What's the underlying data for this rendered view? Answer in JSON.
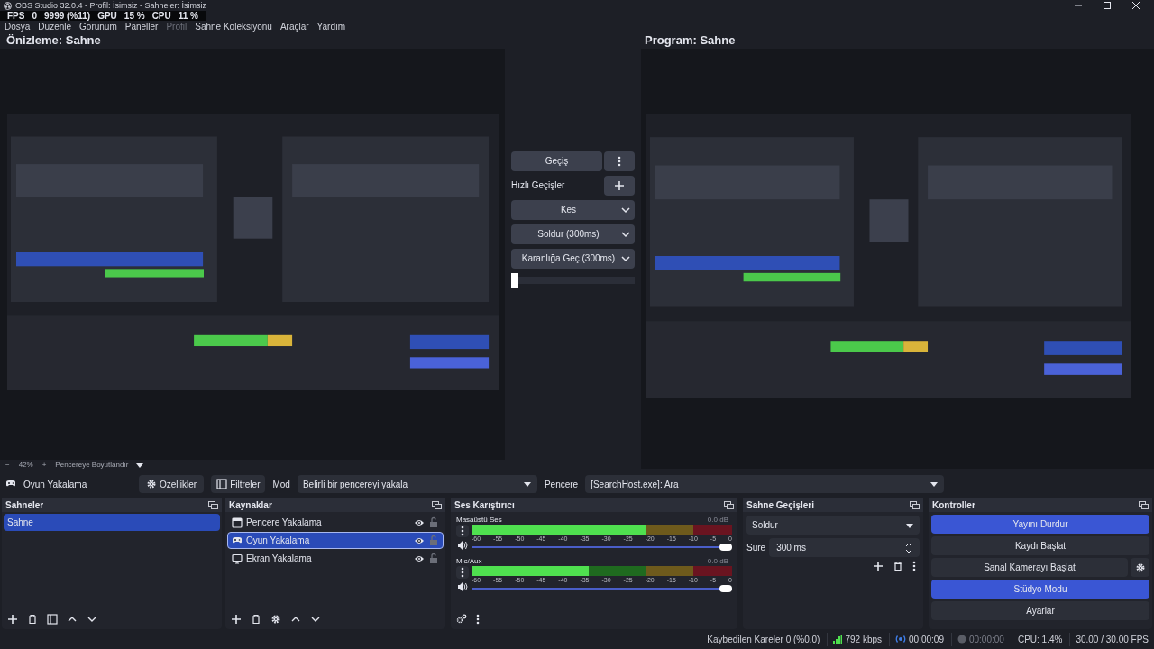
{
  "window": {
    "title": "OBS Studio 32.0.4 - Profil: İsimsiz - Sahneler: İsimsiz"
  },
  "stats_overlay": {
    "fps_label": "FPS",
    "fps": "0",
    "frames": "9999 (%11)",
    "gpu_label": "GPU",
    "gpu": "15 %",
    "cpu_label": "CPU",
    "cpu": "11 %"
  },
  "menu": [
    {
      "label": "Dosya",
      "disabled": false
    },
    {
      "label": "Düzenle",
      "disabled": false
    },
    {
      "label": "Görünüm",
      "disabled": false
    },
    {
      "label": "Paneller",
      "disabled": false
    },
    {
      "label": "Profil",
      "disabled": true
    },
    {
      "label": "Sahne Koleksiyonu",
      "disabled": false
    },
    {
      "label": "Araçlar",
      "disabled": false
    },
    {
      "label": "Yardım",
      "disabled": false
    }
  ],
  "preview": {
    "title": "Önizleme: Sahne"
  },
  "program": {
    "title": "Program: Sahne"
  },
  "transitions_panel": {
    "transition_button": "Geçiş",
    "quick_label": "Hızlı Geçişler",
    "quick": [
      "Kes",
      "Soldur (300ms)",
      "Karanlığa Geç (300ms)"
    ],
    "tbar": {
      "level": 0
    }
  },
  "zoom_bar": {
    "minus": "−",
    "zoom": "42%",
    "plus": "+",
    "fit": "Pencereye Boyutlandır"
  },
  "source_toolbar": {
    "source": "Oyun Yakalama",
    "properties": "Özellikler",
    "filters": "Filtreler",
    "mode_label": "Mod",
    "mode": "Belirli bir pencereyi yakala",
    "window_label": "Pencere",
    "window": "[SearchHost.exe]: Ara"
  },
  "scenes": {
    "title": "Sahneler",
    "items": [
      {
        "label": "Sahne",
        "selected": true
      }
    ]
  },
  "sources": {
    "title": "Kaynaklar",
    "items": [
      {
        "label": "Pencere Yakalama",
        "kind": "window",
        "selected": false,
        "visible": true,
        "locked": false
      },
      {
        "label": "Oyun Yakalama",
        "kind": "game",
        "selected": true,
        "visible": true,
        "locked": false
      },
      {
        "label": "Ekran Yakalama",
        "kind": "display",
        "selected": false,
        "visible": true,
        "locked": false
      }
    ]
  },
  "mixer": {
    "title": "Ses Karıştırıcı",
    "channels": [
      {
        "name": "Masaüstü Ses",
        "reading": "0.0 dB",
        "level": 0.67,
        "volume": {
          "level": 1
        },
        "ticks": [
          "-60",
          "-55",
          "-50",
          "-45",
          "-40",
          "-35",
          "-30",
          "-25",
          "-20",
          "-15",
          "-10",
          "-5",
          "0"
        ]
      },
      {
        "name": "Mic/Aux",
        "reading": "0.0 dB",
        "level": 0.45,
        "volume": {
          "level": 1
        },
        "ticks": [
          "-60",
          "-55",
          "-50",
          "-45",
          "-40",
          "-35",
          "-30",
          "-25",
          "-20",
          "-15",
          "-10",
          "-5",
          "0"
        ]
      }
    ]
  },
  "scene_transitions": {
    "title": "Sahne Geçişleri",
    "transition": "Soldur",
    "duration_label": "Süre",
    "duration": "300 ms"
  },
  "controls": {
    "title": "Kontroller",
    "buttons": [
      {
        "label": "Yayını Durdur",
        "active": true,
        "kind": "plain"
      },
      {
        "label": "Kaydı Başlat",
        "active": false,
        "kind": "plain"
      },
      {
        "label": "Sanal Kamerayı Başlat",
        "active": false,
        "kind": "with_settings"
      },
      {
        "label": "Stüdyo Modu",
        "active": true,
        "kind": "plain"
      },
      {
        "label": "Ayarlar",
        "active": false,
        "kind": "plain"
      }
    ]
  },
  "status_bar": {
    "dropped": "Kaybedilen Kareler 0 (%0.0)",
    "bitrate": "792 kbps",
    "stream_time": "00:00:09",
    "record_time": "00:00:00",
    "cpu": "CPU: 1.4%",
    "fps": "30.00 / 30.00 FPS"
  }
}
